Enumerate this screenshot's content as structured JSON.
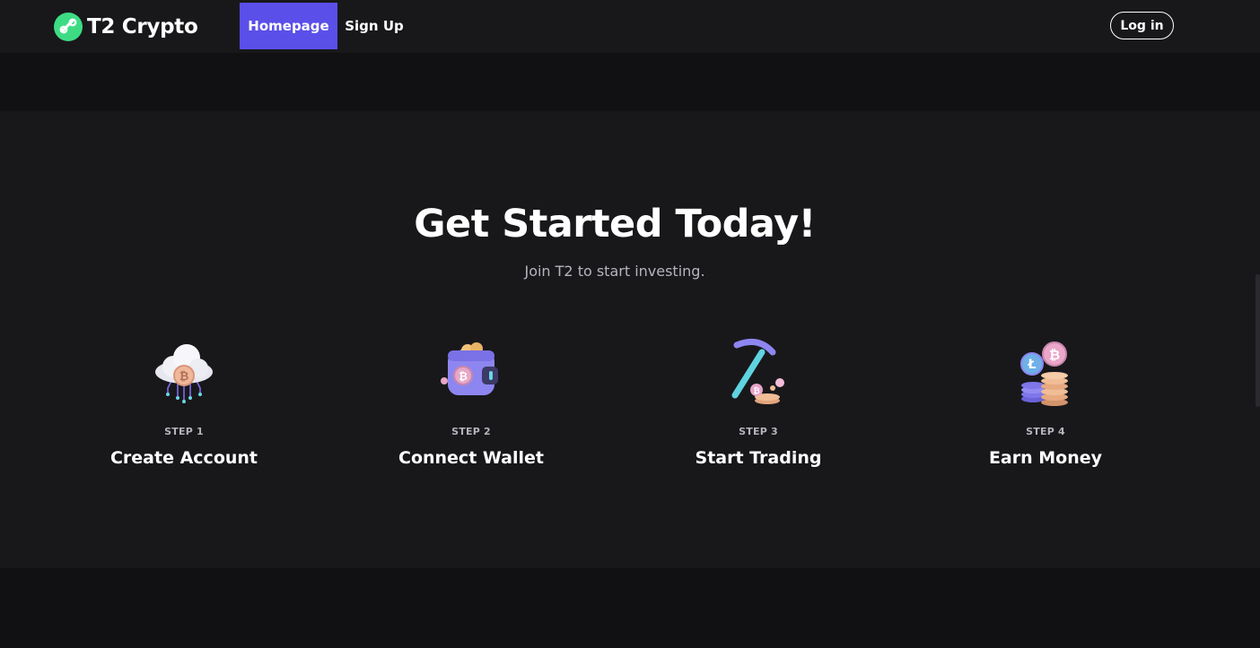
{
  "nav": {
    "brand": "T2 Crypto",
    "links": [
      {
        "label": "Homepage",
        "active": true
      },
      {
        "label": "Sign Up",
        "active": false
      }
    ],
    "login_label": "Log in"
  },
  "hero": {
    "title": "Get Started Today!",
    "subtitle": "Join T2 to start investing."
  },
  "steps": [
    {
      "label": "STEP 1",
      "title": "Create Account",
      "icon": "cloud-bitcoin-icon"
    },
    {
      "label": "STEP 2",
      "title": "Connect Wallet",
      "icon": "wallet-icon"
    },
    {
      "label": "STEP 3",
      "title": "Start Trading",
      "icon": "pickaxe-coins-icon"
    },
    {
      "label": "STEP 4",
      "title": "Earn Money",
      "icon": "coin-stack-icon"
    }
  ],
  "colors": {
    "accent": "#5a4fe9",
    "brand_green": "#3ddc84",
    "background": "#111113",
    "surface": "#18181b",
    "muted_text": "#b4b4bd"
  }
}
